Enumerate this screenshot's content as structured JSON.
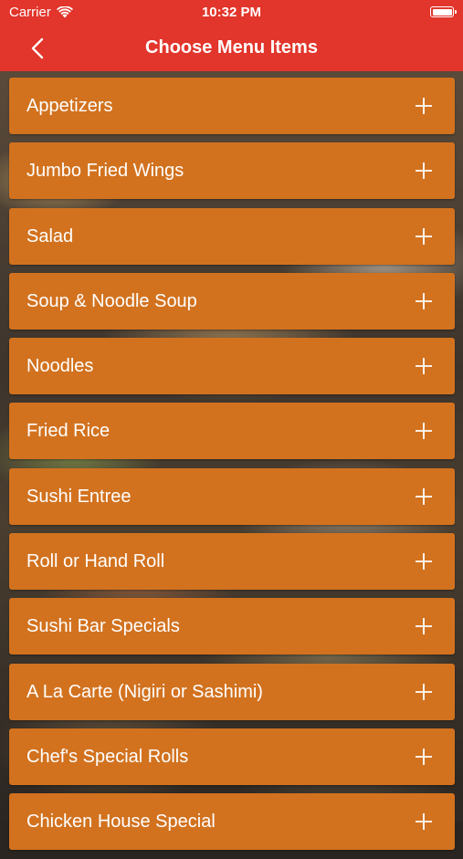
{
  "status_bar": {
    "carrier": "Carrier",
    "time": "10:32 PM",
    "battery_level": 1.0
  },
  "nav": {
    "title": "Choose Menu Items",
    "back_icon": "chevron-left-icon",
    "color": "#e2352b"
  },
  "menu": {
    "item_color": "#d2721f",
    "expand_icon": "plus-icon",
    "items": [
      {
        "label": "Appetizers"
      },
      {
        "label": "Jumbo Fried Wings"
      },
      {
        "label": "Salad"
      },
      {
        "label": "Soup & Noodle Soup"
      },
      {
        "label": "Noodles"
      },
      {
        "label": "Fried Rice"
      },
      {
        "label": "Sushi Entree"
      },
      {
        "label": "Roll or Hand Roll"
      },
      {
        "label": "Sushi Bar Specials"
      },
      {
        "label": "A La Carte (Nigiri or Sashimi)"
      },
      {
        "label": "Chef's Special Rolls"
      },
      {
        "label": "Chicken House Special"
      }
    ]
  }
}
